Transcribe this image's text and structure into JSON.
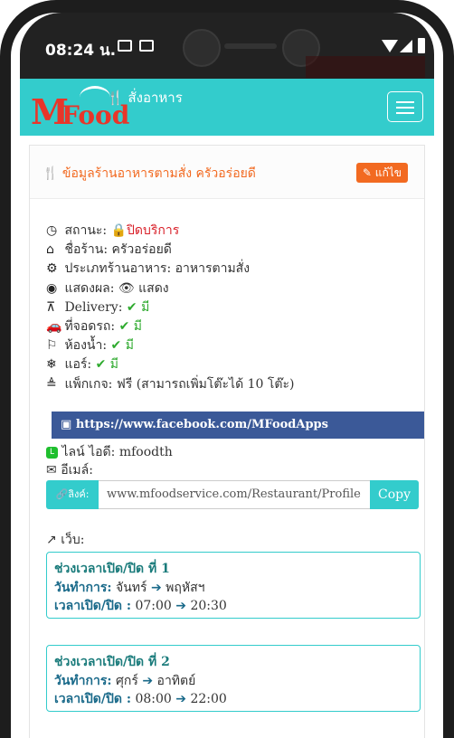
{
  "status_bar": {
    "time": "08:24 น."
  },
  "navbar": {
    "brand_m": "M",
    "brand_food": "Food",
    "title": "สั่งอาหาร"
  },
  "card": {
    "title": "ข้อมูลร้านอาหารตามสั่ง ครัวอร่อยดี",
    "edit_label": "แก้ไข"
  },
  "info": {
    "status_label": "สถานะ:",
    "status_value": "ปิดบริการ",
    "name_label": "ชื่อร้าน:",
    "name_value": "ครัวอร่อยดี",
    "type_label": "ประเภทร้านอาหาร:",
    "type_value": "อาหารตามสั่ง",
    "display_label": "แสดงผล:",
    "display_value": "แสดง",
    "delivery_label": "Delivery:",
    "delivery_value": "มี",
    "parking_label": "ที่จอดรถ:",
    "parking_value": "มี",
    "toilet_label": "ห้องน้ำ:",
    "toilet_value": "มี",
    "aircon_label": "แอร์:",
    "aircon_value": "มี",
    "package_label": "แพ็กเกจ:",
    "package_value": "ฟรี (สามารถเพิ่มโต๊ะได้ 10 โต๊ะ)"
  },
  "facebook": {
    "url": "https://www.facebook.com/MFoodApps"
  },
  "line": {
    "label": "ไลน์ ไอดี:",
    "value": "mfoodth"
  },
  "email": {
    "label": "อีเมล์:"
  },
  "link": {
    "prefix": "ลิงค์:",
    "value": "www.mfoodservice.com/Restaurant/Profile",
    "copy_label": "Copy"
  },
  "web": {
    "label": "เว็บ:"
  },
  "slots": [
    {
      "heading": "ช่วงเวลาเปิด/ปิด ที่ 1",
      "days_label": "วันทำการ:",
      "day_from": "จันทร์",
      "day_to": "พฤหัสฯ",
      "time_label": "เวลาเปิด/ปิด :",
      "time_from": "07:00",
      "time_to": "20:30"
    },
    {
      "heading": "ช่วงเวลาเปิด/ปิด ที่ 2",
      "days_label": "วันทำการ:",
      "day_from": "ศุกร์",
      "day_to": "อาทิตย์",
      "time_label": "เวลาเปิด/ปิด :",
      "time_from": "08:00",
      "time_to": "22:00"
    }
  ],
  "colors": {
    "accent": "#33cccc",
    "orange": "#f26a21",
    "facebook": "#3b5998",
    "closed_red": "#d9212a",
    "check_green": "#2eaa2e"
  }
}
